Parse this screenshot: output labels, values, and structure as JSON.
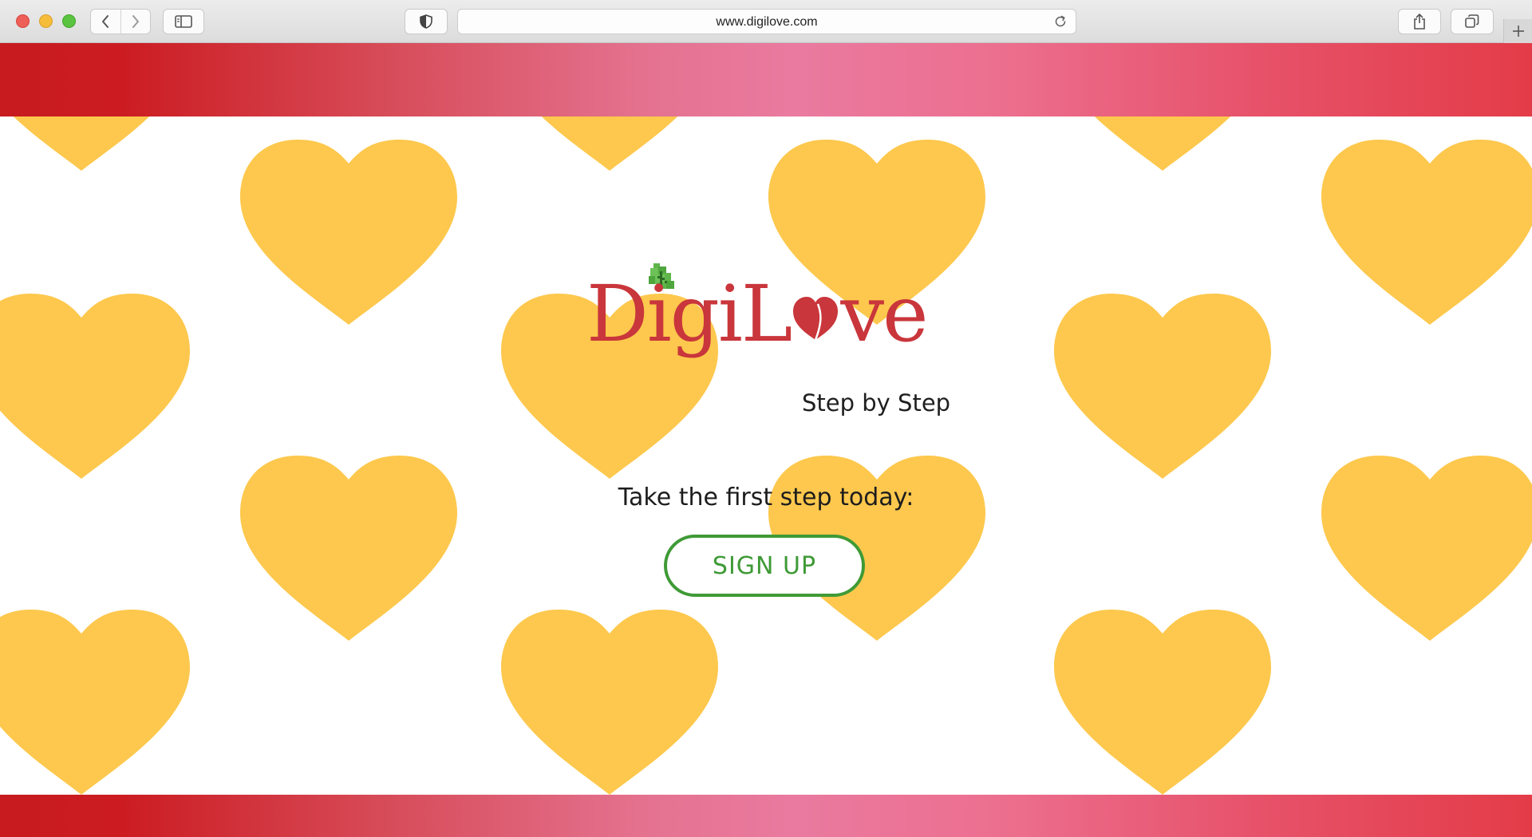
{
  "browser": {
    "url": "www.digilove.com",
    "icons": {
      "close": "close-window-icon",
      "minimize": "minimize-window-icon",
      "zoom": "zoom-window-icon",
      "back": "chevron-left-icon",
      "forward": "chevron-right-icon",
      "sidebar": "sidebar-icon",
      "privacy": "shield-icon",
      "reload": "reload-icon",
      "share": "share-icon",
      "tabs": "tab-overview-icon",
      "new_tab": "plus-icon"
    }
  },
  "site": {
    "logo_prefix": "DigiL",
    "logo_suffix": "ve",
    "tagline": "Step by Step",
    "cta_text": "Take the first step today:",
    "signup_label": "SIGN UP"
  },
  "colors": {
    "brand_red": "#c9363b",
    "heart_yellow": "#fdc84d",
    "signup_green": "#3f9a36",
    "band_start": "#c71b1f",
    "band_mid": "#ea7aa0",
    "band_end": "#e33c48"
  }
}
